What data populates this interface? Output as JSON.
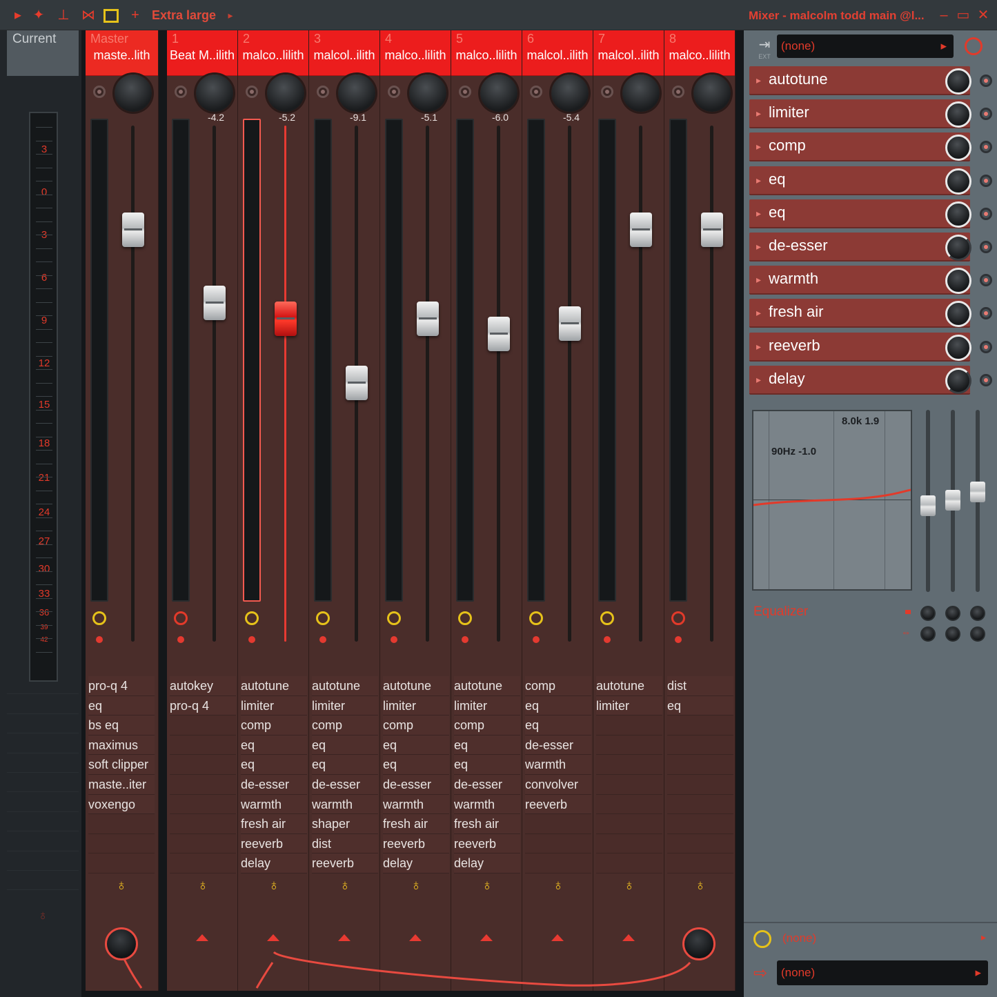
{
  "toolbar": {
    "size_label": "Extra large",
    "window_title": "Mixer - malcolm todd main @l..."
  },
  "current": {
    "tab_label": "Current",
    "scale": [
      "3",
      "0",
      "3",
      "6",
      "9",
      "12",
      "15",
      "18",
      "21",
      "24",
      "27",
      "30",
      "33",
      "36",
      "39",
      "42"
    ]
  },
  "strips": [
    {
      "num": "Master",
      "name": "maste..lith",
      "pan": "",
      "fx": [
        "pro-q 4",
        "eq",
        "bs eq",
        "maximus",
        "soft clipper",
        "maste..iter",
        "voxengo"
      ]
    },
    {
      "num": "1",
      "name": "Beat M..ilith",
      "pan": "-4.2",
      "fx": [
        "autokey",
        "pro-q 4"
      ]
    },
    {
      "num": "2",
      "name": "malco..lilith",
      "pan": "-5.2",
      "fx": [
        "autotune",
        "limiter",
        "comp",
        "eq",
        "eq",
        "de-esser",
        "warmth",
        "fresh air",
        "reeverb",
        "delay"
      ]
    },
    {
      "num": "3",
      "name": "malcol..ilith",
      "pan": "-9.1",
      "fx": [
        "autotune",
        "limiter",
        "comp",
        "eq",
        "eq",
        "de-esser",
        "warmth",
        "shaper",
        "dist",
        "reeverb"
      ]
    },
    {
      "num": "4",
      "name": "malco..lilith",
      "pan": "-5.1",
      "fx": [
        "autotune",
        "limiter",
        "comp",
        "eq",
        "eq",
        "de-esser",
        "warmth",
        "fresh air",
        "reeverb",
        "delay"
      ]
    },
    {
      "num": "5",
      "name": "malco..lilith",
      "pan": "-6.0",
      "fx": [
        "autotune",
        "limiter",
        "comp",
        "eq",
        "eq",
        "de-esser",
        "warmth",
        "fresh air",
        "reeverb",
        "delay"
      ]
    },
    {
      "num": "6",
      "name": "malcol..ilith",
      "pan": "-5.4",
      "fx": [
        "comp",
        "eq",
        "eq",
        "de-esser",
        "warmth",
        "convolver",
        "reeverb"
      ]
    },
    {
      "num": "7",
      "name": "malcol..ilith",
      "pan": "",
      "fx": [
        "autotune",
        "limiter"
      ]
    },
    {
      "num": "8",
      "name": "malco..lilith",
      "pan": "",
      "fx": [
        "dist",
        "eq"
      ]
    }
  ],
  "rack": {
    "preset": "(none)",
    "ext_label": "EXT",
    "slots": [
      "autotune",
      "limiter",
      "comp",
      "eq",
      "eq",
      "de-esser",
      "warmth",
      "fresh air",
      "reeverb",
      "delay"
    ],
    "eq": {
      "label": "Equalizer",
      "low_band": "90Hz -1.0",
      "high_band": "8.0k 1.9"
    },
    "bottom_preset": "(none)",
    "output": "(none)"
  },
  "colors": {
    "accent": "#ec1d1d",
    "strip_bg": "#4a2d2a",
    "rack_bg": "#616c73"
  }
}
